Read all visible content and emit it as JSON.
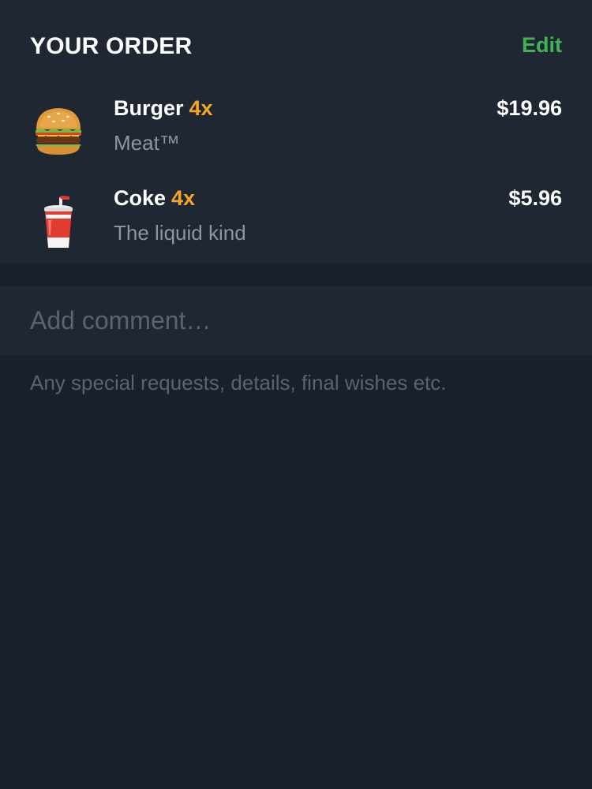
{
  "order": {
    "title": "YOUR ORDER",
    "edit_label": "Edit",
    "items": [
      {
        "name": "Burger",
        "quantity": "4x",
        "description": "Meat™",
        "price": "$19.96",
        "icon": "burger-icon"
      },
      {
        "name": "Coke",
        "quantity": "4x",
        "description": "The liquid kind",
        "price": "$5.96",
        "icon": "drink-cup-icon"
      }
    ]
  },
  "comment": {
    "placeholder": "Add comment…",
    "hint": "Any special requests, details, final wishes etc."
  },
  "colors": {
    "accent_green": "#40b551",
    "quantity_orange": "#f5a623",
    "card_bg": "#1f2733",
    "page_bg": "#18202a"
  }
}
